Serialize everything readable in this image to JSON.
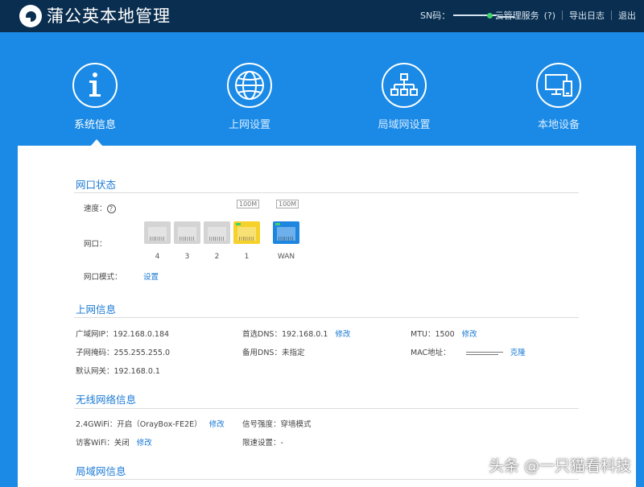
{
  "header": {
    "app_title": "蒲公英本地管理",
    "sn_label": "SN码：",
    "cloud_service": "云管理服务",
    "cloud_help": "(?)",
    "export_log": "导出日志",
    "logout": "退出"
  },
  "nav": {
    "items": [
      {
        "label": "系统信息",
        "icon": "info-icon",
        "active": true
      },
      {
        "label": "上网设置",
        "icon": "globe-icon",
        "active": false
      },
      {
        "label": "局域网设置",
        "icon": "network-tree-icon",
        "active": false
      },
      {
        "label": "本地设备",
        "icon": "devices-icon",
        "active": false
      }
    ]
  },
  "port_status": {
    "title": "网口状态",
    "speed_label": "速度：",
    "ports_label": "网口：",
    "mode_label": "网口模式：",
    "mode_link": "设置",
    "ports": [
      {
        "name": "4",
        "state": "disconnected",
        "color": "#d4d4d4",
        "speed": ""
      },
      {
        "name": "3",
        "state": "disconnected",
        "color": "#d4d4d4",
        "speed": ""
      },
      {
        "name": "2",
        "state": "disconnected",
        "color": "#d4d4d4",
        "speed": ""
      },
      {
        "name": "1",
        "state": "connected",
        "color": "#f5d12a",
        "speed": "100M"
      },
      {
        "name": "WAN",
        "state": "connected",
        "color": "#1f86e0",
        "speed": "100M"
      }
    ]
  },
  "internet_info": {
    "title": "上网信息",
    "wan_ip_label": "广域网IP：",
    "wan_ip": "192.168.0.184",
    "subnet_label": "子网掩码：",
    "subnet": "255.255.255.0",
    "gateway_label": "默认网关：",
    "gateway": "192.168.0.1",
    "dns1_label": "首选DNS：",
    "dns1": "192.168.0.1",
    "dns1_edit": "修改",
    "dns2_label": "备用DNS：",
    "dns2": "未指定",
    "mtu_label": "MTU：",
    "mtu": "1500",
    "mtu_edit": "修改",
    "mac_label": "MAC地址：",
    "mac_clone": "克隆"
  },
  "wireless_info": {
    "title": "无线网络信息",
    "wifi24_label": "2.4GWiFi：",
    "wifi24_value": "开启（OrayBox-FE2E）",
    "wifi24_edit": "修改",
    "guest_label": "访客WiFi：",
    "guest_value": "关闭",
    "guest_edit": "修改",
    "signal_label": "信号强度：",
    "signal_value": "穿墙模式",
    "rate_label": "限速设置：",
    "rate_value": "-"
  },
  "lan_info": {
    "title": "局域网信息"
  },
  "watermark": "头条 @一只猫看科技",
  "colors": {
    "header_bg": "#0a2e4f",
    "page_bg": "#1a8ae6",
    "accent": "#1a7ad4",
    "port_active_lan": "#f5d12a",
    "port_active_wan": "#1f86e0",
    "port_inactive": "#d4d4d4",
    "led_green": "#3fd26a"
  }
}
